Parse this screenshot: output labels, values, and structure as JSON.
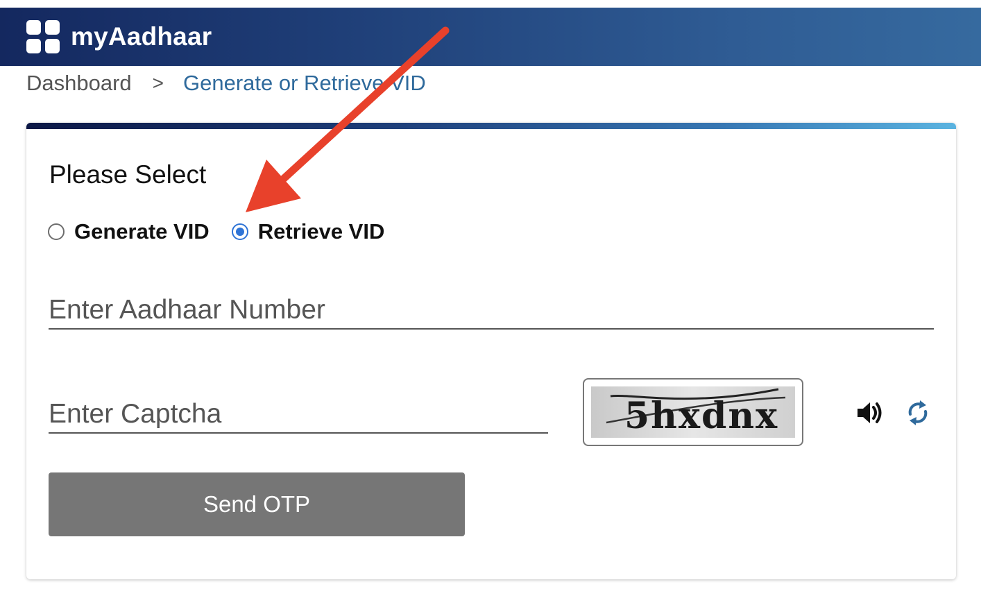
{
  "header": {
    "brand": "myAadhaar",
    "logo_icon": "grid-logo-icon"
  },
  "breadcrumb": {
    "home": "Dashboard",
    "separator": ">",
    "current": "Generate or Retrieve VID"
  },
  "form": {
    "title": "Please Select",
    "options": [
      {
        "label": "Generate VID",
        "checked": false
      },
      {
        "label": "Retrieve VID",
        "checked": true
      }
    ],
    "aadhaar_placeholder": "Enter Aadhaar Number",
    "captcha_placeholder": "Enter Captcha",
    "captcha_text": "5hxdnx",
    "audio_icon": "speaker-icon",
    "refresh_icon": "refresh-icon",
    "submit_label": "Send OTP"
  },
  "colors": {
    "accent": "#2f74d6",
    "breadcrumb_link": "#2f6a9c",
    "annotation": "#e8412b",
    "button": "#767676"
  }
}
